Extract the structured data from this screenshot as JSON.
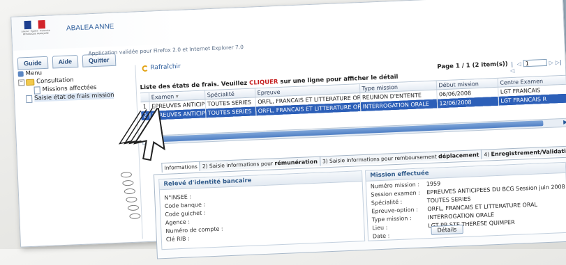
{
  "header": {
    "logo_text": "Liberté · Égalité · Fraternité RÉPUBLIQUE FRANÇAISE",
    "user_name": "ABALEA ANNE",
    "app_note": "Application validée pour Firefox 2.0 et Internet Explorer 7.0"
  },
  "tabs": [
    {
      "label": "Guide"
    },
    {
      "label": "Aide"
    },
    {
      "label": "Quitter"
    }
  ],
  "sidebar": {
    "menu_label": "Menu",
    "consultation_label": "Consultation",
    "missions_label": "Missions affectées",
    "saisie_label": "Saisie état de frais mission"
  },
  "toolbar": {
    "refresh_label": "Rafraîchir"
  },
  "grid": {
    "title_prefix": "Liste des états de frais. Veuillez ",
    "title_cta": "CLIQUER",
    "title_suffix": " sur une ligne pour afficher le détail",
    "pager_label": "Page 1 / 1 (2 item(s))",
    "pager_input_value": "1",
    "columns": [
      "Examen",
      "Spécialité",
      "Epreuve",
      "Type mission",
      "Début mission",
      "Centre Examen"
    ],
    "rows": [
      [
        "EPREUVES ANTICIP",
        "TOUTES SERIES",
        "ORFL, FRANCAIS ET LITTERATURE ORAL",
        "REUNION D'ENTENTE",
        "06/06/2008",
        "LGT FRANCAIS"
      ],
      [
        "EPREUVES ANTICIP",
        "TOUTES SERIES",
        "ORFL, FRANCAIS ET LITTERATURE ORAL",
        "INTERROGATION ORALE",
        "12/06/2008",
        "LGT FRANCAIS R"
      ]
    ],
    "row_numbers": [
      "1",
      "2"
    ]
  },
  "wizard": {
    "tab1": "Informations",
    "tab2_prefix": "2) Saisie informations pour ",
    "tab2_bold": "rémunération",
    "tab3_prefix": "3) Saisie informations pour remboursement ",
    "tab3_bold": "déplacement",
    "tab4_prefix": "4) ",
    "tab4_bold": "Enregistrement/Validation"
  },
  "bank_panel": {
    "title": "Relevé d'identité bancaire",
    "fields": [
      {
        "label": "N°INSEE :"
      },
      {
        "label": "Code banque :"
      },
      {
        "label": "Code guichet :"
      },
      {
        "label": "Agence :"
      },
      {
        "label": "Numéro de compte :"
      },
      {
        "label": "Clé RIB :"
      }
    ]
  },
  "mission_panel": {
    "title": "Mission effectuée",
    "fields": [
      {
        "label": "Numéro mission :",
        "value": "1959"
      },
      {
        "label": "Session examen :",
        "value": "EPREUVES ANTICIPEES DU BCG Session juin 2008"
      },
      {
        "label": "Spécialité :",
        "value": "TOUTES SERIES"
      },
      {
        "label": "Epreuve-option :",
        "value": "ORFL, FRANCAIS ET LITTERATURE ORAL"
      },
      {
        "label": "Type mission :",
        "value": "INTERROGATION ORALE"
      },
      {
        "label": "Lieu :",
        "value": "LGT PR STE THERESE QUIMPER"
      },
      {
        "label": "Date :",
        "value": ""
      }
    ],
    "details_button": "Détails"
  },
  "colors": {
    "selected_row": "#2c5fb8",
    "accent_blue": "#2a5b9a",
    "cta_red": "#c51d1d"
  }
}
